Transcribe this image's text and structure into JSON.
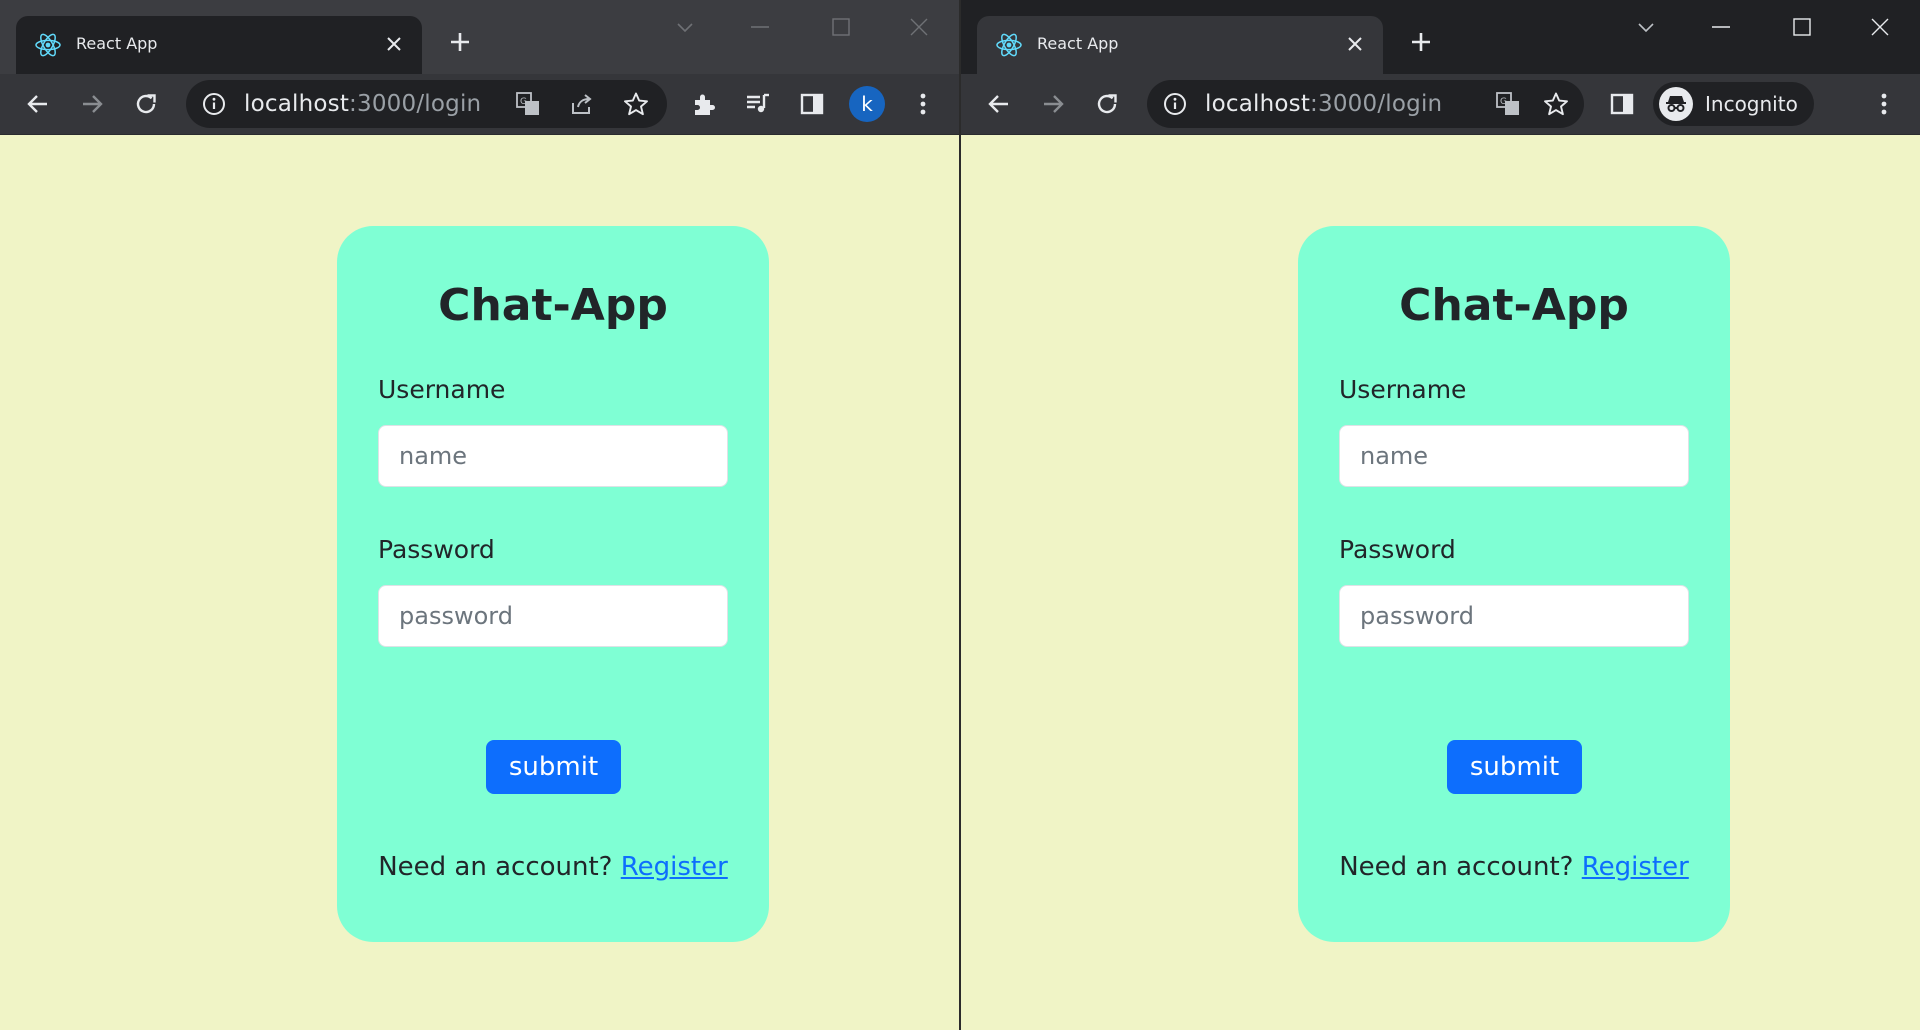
{
  "colors": {
    "page_background": "#f0f4c6",
    "card_background": "#7fffd4",
    "button_primary": "#0d6efd",
    "link": "#0d6efd",
    "chrome_dark": "#202124",
    "chrome_toolbar": "#35363a"
  },
  "left_window": {
    "tab": {
      "title": "React App",
      "favicon": "react-logo-icon"
    },
    "address": {
      "host": "localhost",
      "rest": ":3000/login"
    },
    "profile_initial": "k"
  },
  "right_window": {
    "tab": {
      "title": "React App",
      "favicon": "react-logo-icon"
    },
    "address": {
      "host": "localhost",
      "rest": ":3000/login"
    },
    "incognito_label": "Incognito"
  },
  "login": {
    "title": "Chat-App",
    "username_label": "Username",
    "username_placeholder": "name",
    "password_label": "Password",
    "password_placeholder": "password",
    "submit_label": "submit",
    "register_prompt": "Need an account? ",
    "register_link": "Register"
  }
}
